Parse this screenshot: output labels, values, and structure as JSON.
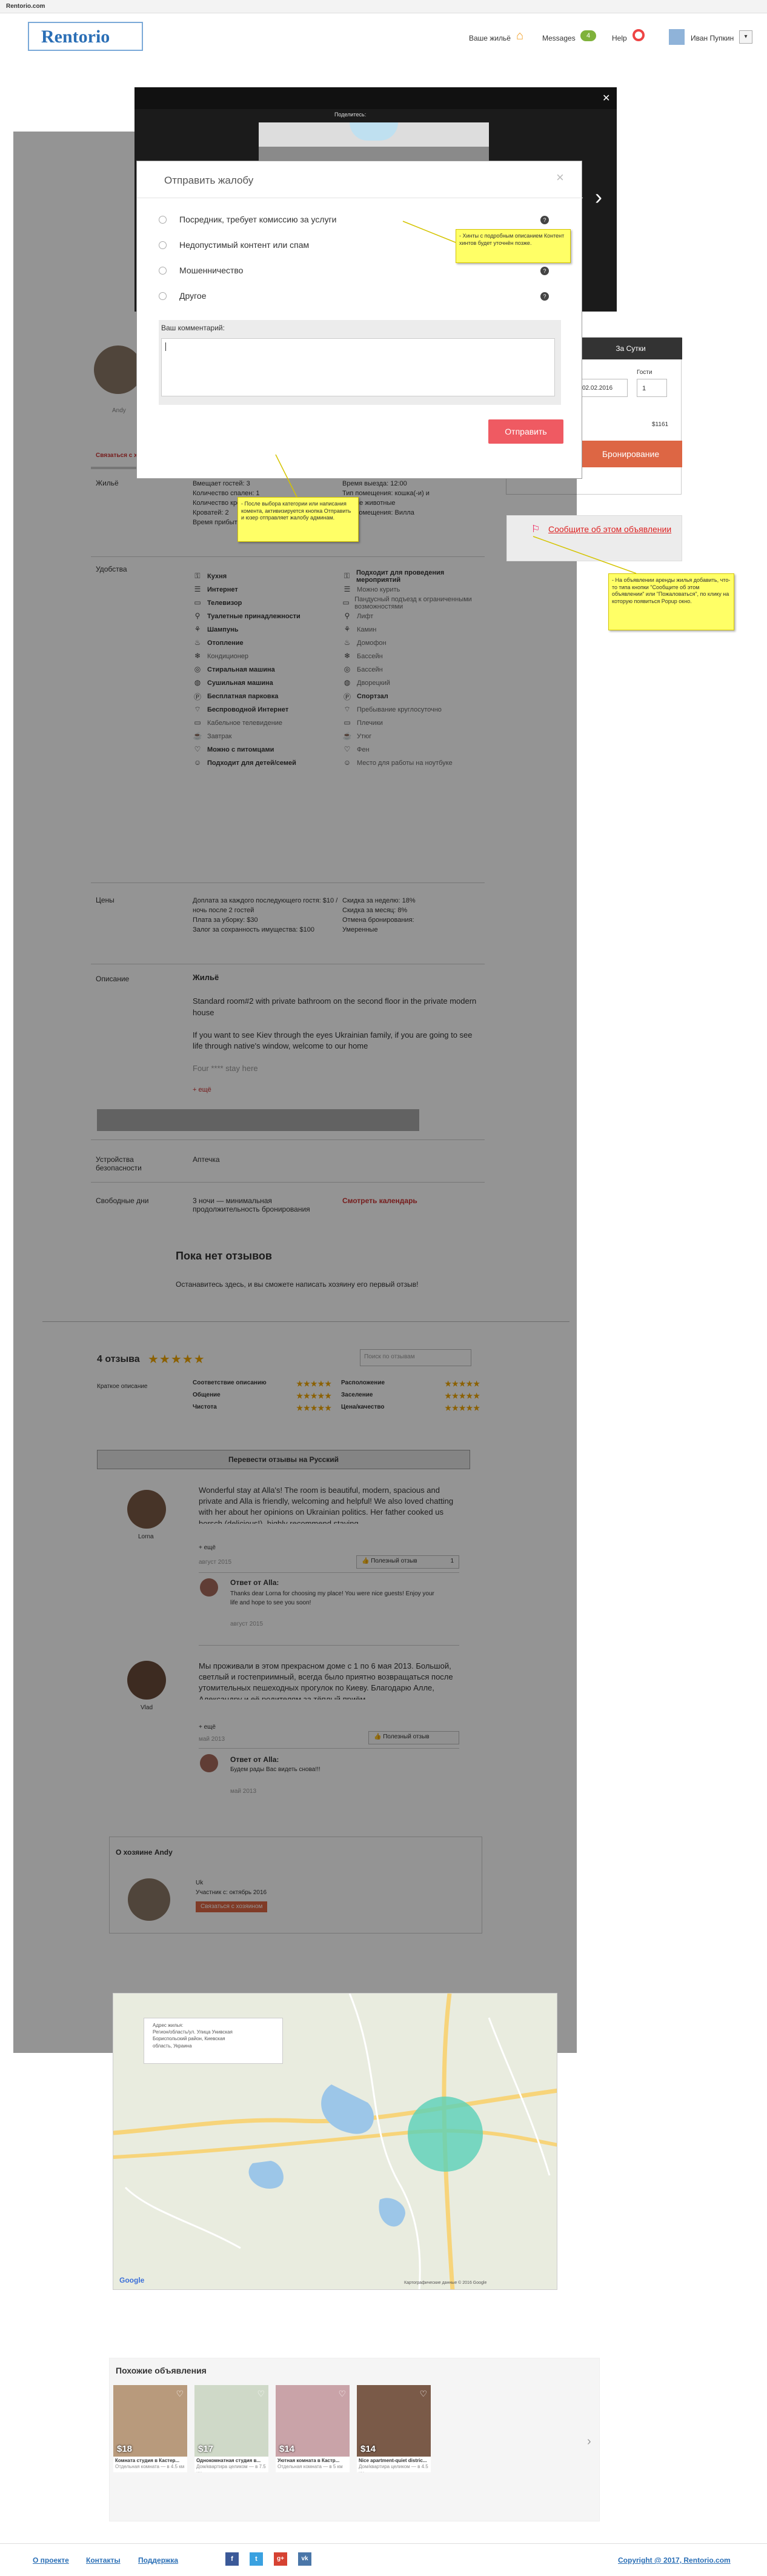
{
  "browser": {
    "url": "Rentorio.com"
  },
  "header": {
    "logo": "Rentorio",
    "menu_listings": "Ваше жильё",
    "menu_messages": "Messages",
    "messages_count": "4",
    "menu_help": "Help",
    "user_name": "Иван Пупкин"
  },
  "gallery": {
    "toolbar_text": "Поделитесь:",
    "arrow_right": "›"
  },
  "complaint": {
    "title": "Отправить жалобу",
    "options": [
      "Посредник, требует комиссию за услуги",
      "Недопустимый контент или спам",
      "Мошенничество",
      "Другое"
    ],
    "comment_label": "Ваш комментарий:",
    "submit": "Отправить",
    "close": "×"
  },
  "notes": {
    "hints": "- Хинты с подробным описанием Контент хинтов будет уточнён позже.",
    "after_select": "- После выбора категории или написания комента, активизируется кнопка Отправить и юзер отправляет жалобу админам.",
    "report": "- На объявлении аренды жилья добавить, что-то типа кнопки \"Сообщите об этом объявлении\" или \"Пожаловаться\", по клику на которую появиться Popup окно."
  },
  "booking": {
    "tab_day": "За Сутки",
    "date_label": "Гости",
    "date_value": "02.02.2016",
    "guests": "1",
    "price": "$1161",
    "book_button": "Бронирование",
    "report_link": "Сообщите об этом объявлении"
  },
  "host_side": {
    "name": "Andy",
    "link": "Связаться с хозяином"
  },
  "details": {
    "housing_label": "Жильё",
    "housing_col1": [
      "Вмещает гостей: 3",
      "Количество спален: 1",
      "Количество кроватей: 1",
      "Кроватей: 2",
      "Время прибытия: 15:00"
    ],
    "housing_col2": [
      "Время выезда: 12:00",
      "Тип помещения: кошка(-и) и",
      "другие животные",
      "Тип помещения: Вилла"
    ],
    "amenities_label": "Удобства",
    "amenities_col1": [
      "Кухня",
      "Интернет",
      "Телевизор",
      "Туалетные принадлежности",
      "Шампунь",
      "Отопление",
      "Кондиционер",
      "Стиральная машина",
      "Сушильная машина",
      "Бесплатная парковка",
      "Беспроводной Интернет",
      "Кабельное телевидение",
      "Завтрак",
      "Можно с питомцами",
      "Подходит для детей/семей"
    ],
    "amenities_col2": [
      "Подходит для проведения мероприятий",
      "Можно курить",
      "Пандусный подъезд к ограниченными возможностями",
      "Лифт",
      "Камин",
      "Домофон",
      "Бассейн",
      "Бассейн",
      "Дворецкий",
      "Спортзал",
      "Пребывание круглосуточно",
      "Плечики",
      "Утюг",
      "Фен",
      "Место для работы на ноутбуке"
    ],
    "prices_label": "Цены",
    "prices_col1": [
      "Доплата за каждого последующего гостя: $10 / ночь после 2 гостей",
      "Плата за уборку: $30",
      "Залог за сохранность имущества: $100"
    ],
    "prices_col2": [
      "Скидка за неделю: 18%",
      "Скидка за месяц: 8%",
      "Отмена бронирования:",
      "Умеренные"
    ],
    "desc_label": "Описание",
    "desc_title": "Жильё",
    "desc_p1": "Standard room#2 with private bathroom on the second floor in the private modern house",
    "desc_p2": "If you want to see Kiev through the eyes Ukrainian family, if you are going to see life through native's window, welcome to our home",
    "desc_p3": "Four **** stay here",
    "desc_more": "+ ещё",
    "safety_label": "Устройства безопасности",
    "safety_value": "Аптечка",
    "free_label": "Свободные дни",
    "free_value": "3 ночи — минимальная продолжительность бронирования",
    "free_link": "Смотреть календарь"
  },
  "noreviews": {
    "title": "Пока нет отзывов",
    "text": "Останавитесь здесь, и вы сможете написать хозяину его первый отзыв!"
  },
  "reviews": {
    "count": "4 отзыва",
    "search_placeholder": "Поиск по отзывам",
    "summary_label": "Краткое описание",
    "ratings": [
      "Соответствие описанию",
      "Общение",
      "Чистота",
      "Расположение",
      "Заселение",
      "Цена/качество"
    ],
    "translate": "Перевести отзывы на Русский",
    "r1_name": "Lorna",
    "r1_text": "Wonderful stay at Alla's! The room is beautiful, modern, spacious and private and Alla is friendly, welcoming and helpful! We also loved chatting with her about her opinions on Ukrainian politics. Her father cooked us borsch (delicious!), highly recommend staying.",
    "r1_more": "+ ещё",
    "r1_date": "август 2015",
    "helpful": "Полезный отзыв",
    "helpful_count": "1",
    "r1_reply_title": "Ответ от Alla:",
    "r1_reply": "Thanks dear Lorna for choosing my place! You were nice guests! Enjoy your life and hope to see you soon!",
    "r1_reply_date": "август 2015",
    "r2_name": "Vlad",
    "r2_text": "Мы проживали в этом прекрасном доме с 1 по 6 мая 2013. Большой, светлый и гостеприимный, всегда было приятно возвращаться после утомительных пешеходных прогулок по Киеву. Благодарю Алле, Александру и её родителям за тёплый приём.",
    "r2_more": "+ ещё",
    "r2_date": "май 2013",
    "r2_reply_title": "Ответ от Alla:",
    "r2_reply": "Будем рады Вас видеть снова!!!",
    "r2_reply_date": "май 2013"
  },
  "host": {
    "title": "О хозяине Andy",
    "line1": "Uk",
    "line2": "Участник с: октябрь 2016",
    "button": "Связаться с хозяином"
  },
  "map": {
    "card_line1": "Адрес жилья:",
    "card_line2": "Регион/область/ул. Улица Унивская",
    "card_line3": "Бориспольский район, Киевская",
    "card_line4": "область, Украина",
    "logo": "Google",
    "footer": "Картографические данные © 2016 Google"
  },
  "similar": {
    "title": "Похожие объявления",
    "items": [
      {
        "price": "$18",
        "caption": "Комната студия в Кастер...",
        "sub": "Отдельная комната — в 4.5 км"
      },
      {
        "price": "$17",
        "caption": "Однокомнатная студия в...",
        "sub": "Дом/квартира целиком — в 7.5 км"
      },
      {
        "price": "$14",
        "caption": "Уютная комната в Кастр...",
        "sub": "Отдельная комната — в 5 км"
      },
      {
        "price": "$14",
        "caption": "Nice apartment-quiet distric...",
        "sub": "Дом/квартира целиком — в 4.5 км"
      }
    ]
  },
  "footer": {
    "about": "О проекте",
    "contacts": "Контакты",
    "support": "Поддержка",
    "copyright": "Copyright @ 2017, Rentorio.com"
  },
  "colors": {
    "brand": "#2b6fb6",
    "accent": "#e05a5a",
    "overlay": "#5d5d5d"
  }
}
